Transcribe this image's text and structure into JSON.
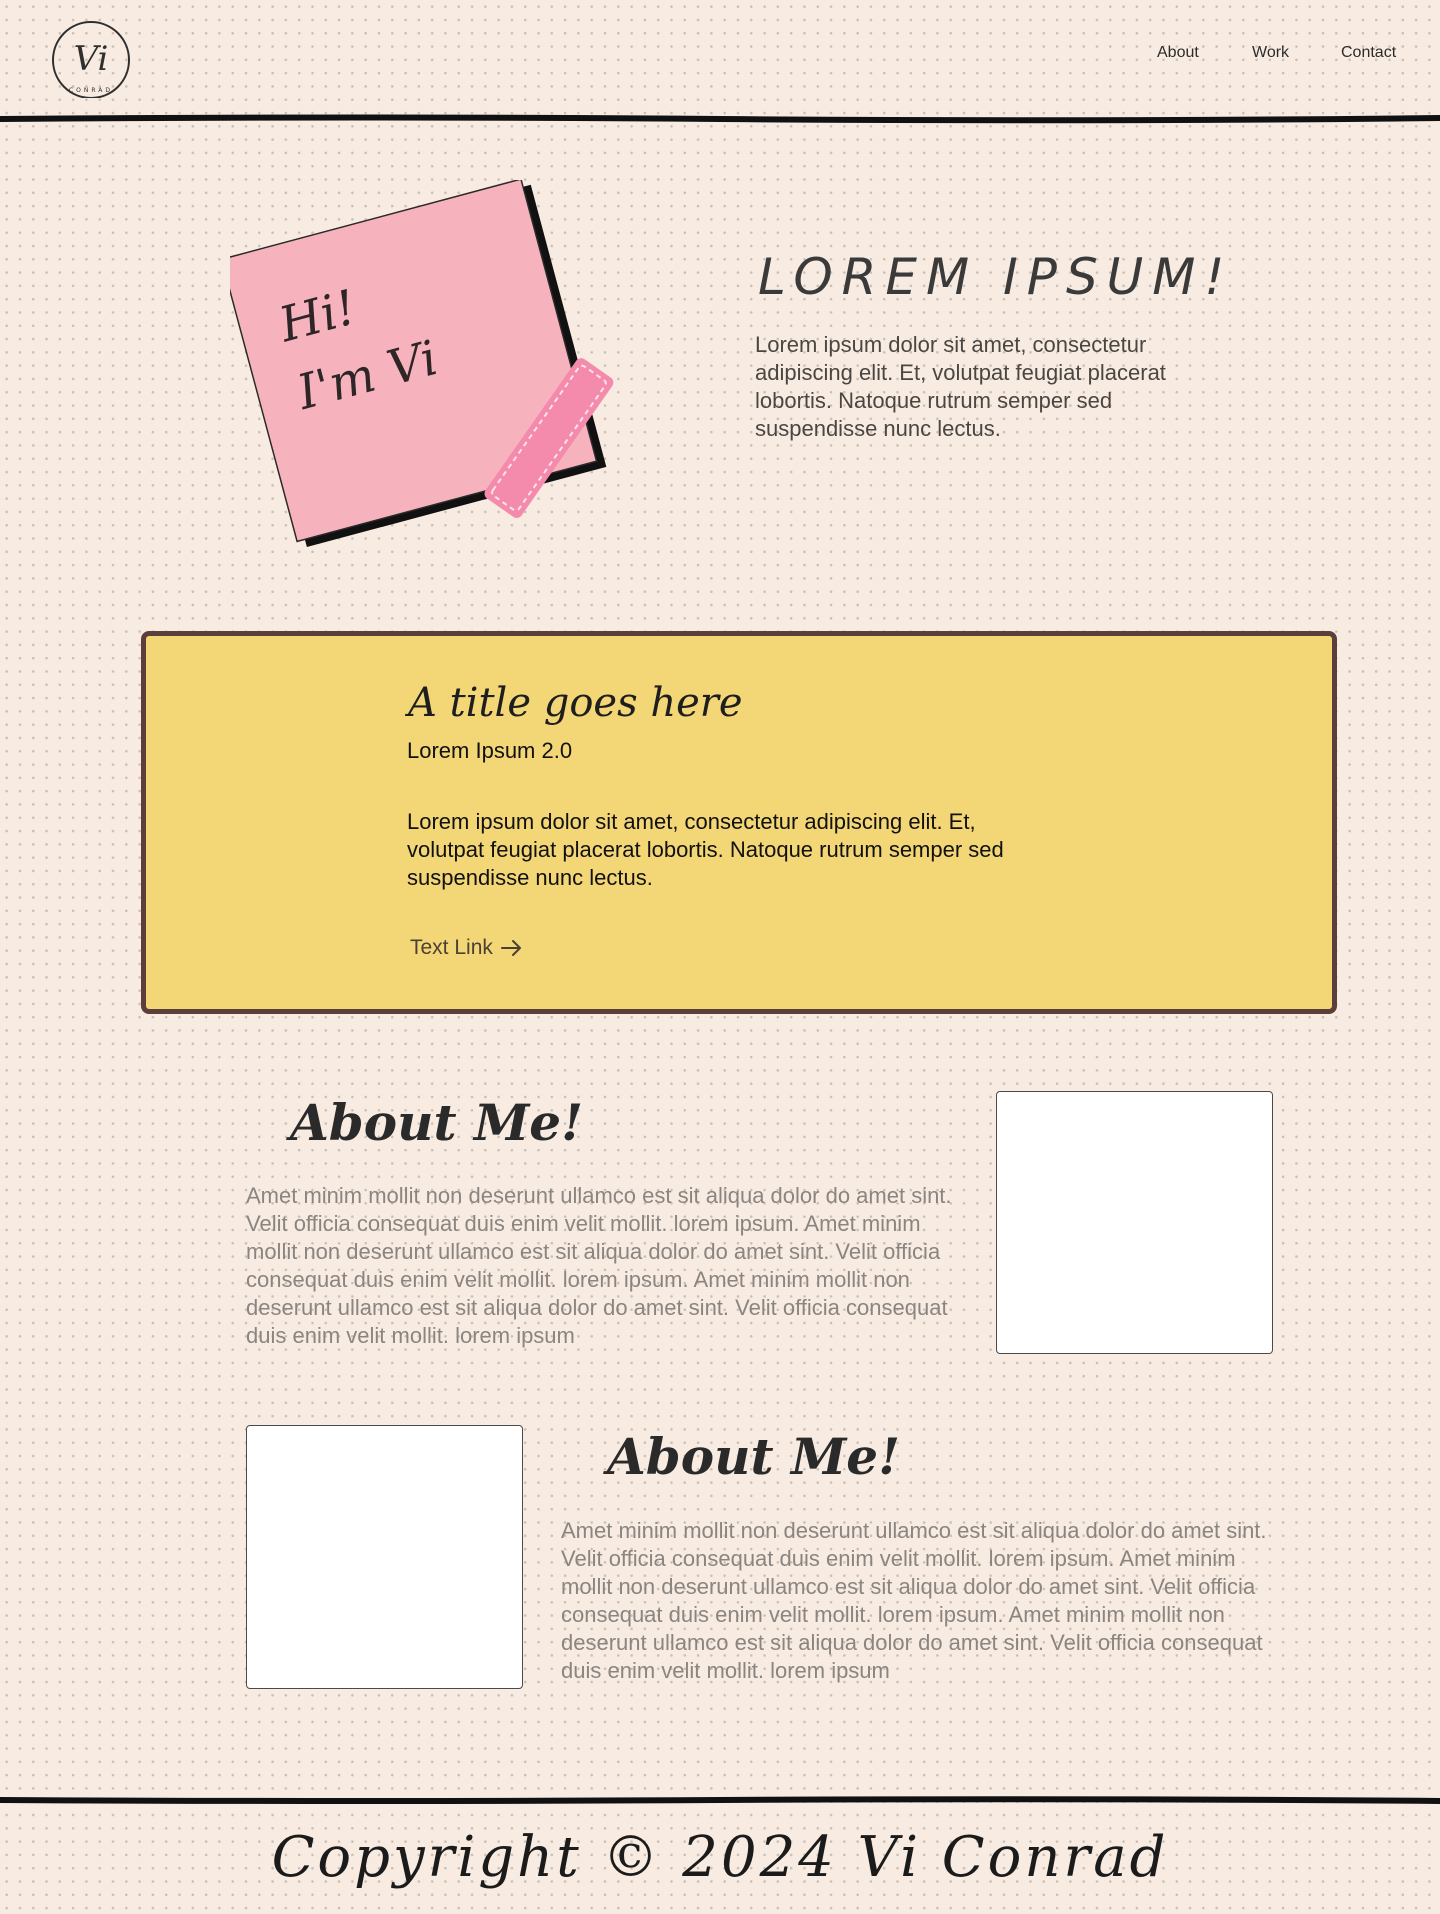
{
  "header": {
    "logo": {
      "monogram": "Vi",
      "ring_text": "CONRAD"
    },
    "nav": [
      {
        "label": "About"
      },
      {
        "label": "Work"
      },
      {
        "label": "Contact"
      }
    ]
  },
  "hero": {
    "sticky_line1": "Hi!",
    "sticky_line2": "I'm Vi",
    "title": "LOREM IPSUM!",
    "text": "Lorem ipsum dolor sit amet, consectetur adipiscing elit. Et, volutpat feugiat placerat lobortis. Natoque rutrum semper sed suspendisse nunc lectus."
  },
  "card": {
    "title": "A title goes here",
    "subtitle": "Lorem Ipsum 2.0",
    "text": "Lorem ipsum dolor sit amet, consectetur adipiscing elit. Et, volutpat feugiat placerat lobortis. Natoque rutrum semper sed suspendisse nunc lectus.",
    "link_label": "Text Link",
    "link_icon": "arrow-right-icon"
  },
  "about": [
    {
      "title": "About Me!",
      "text": "Amet minim mollit non deserunt ullamco est sit aliqua dolor do amet sint. Velit officia consequat duis enim velit mollit. lorem ipsum. Amet minim mollit non deserunt ullamco est sit aliqua dolor do amet sint. Velit officia consequat duis enim velit mollit. lorem ipsum. Amet minim mollit non deserunt ullamco est sit aliqua dolor do amet sint. Velit officia consequat duis enim velit mollit. lorem ipsum"
    },
    {
      "title": "About Me!",
      "text": "Amet minim mollit non deserunt ullamco est sit aliqua dolor do amet sint. Velit officia consequat duis enim velit mollit. lorem ipsum. Amet minim mollit non deserunt ullamco est sit aliqua dolor do amet sint. Velit officia consequat duis enim velit mollit. lorem ipsum. Amet minim mollit non deserunt ullamco est sit aliqua dolor do amet sint. Velit officia consequat duis enim velit mollit. lorem ipsum"
    }
  ],
  "footer": {
    "text": "Copyright © 2024 Vi Conrad"
  },
  "colors": {
    "background": "#f8ece2",
    "sticky_note": "#f7b3bd",
    "tape": "#f58bac",
    "card": "#f3d676",
    "card_border": "#5c3f3b"
  }
}
